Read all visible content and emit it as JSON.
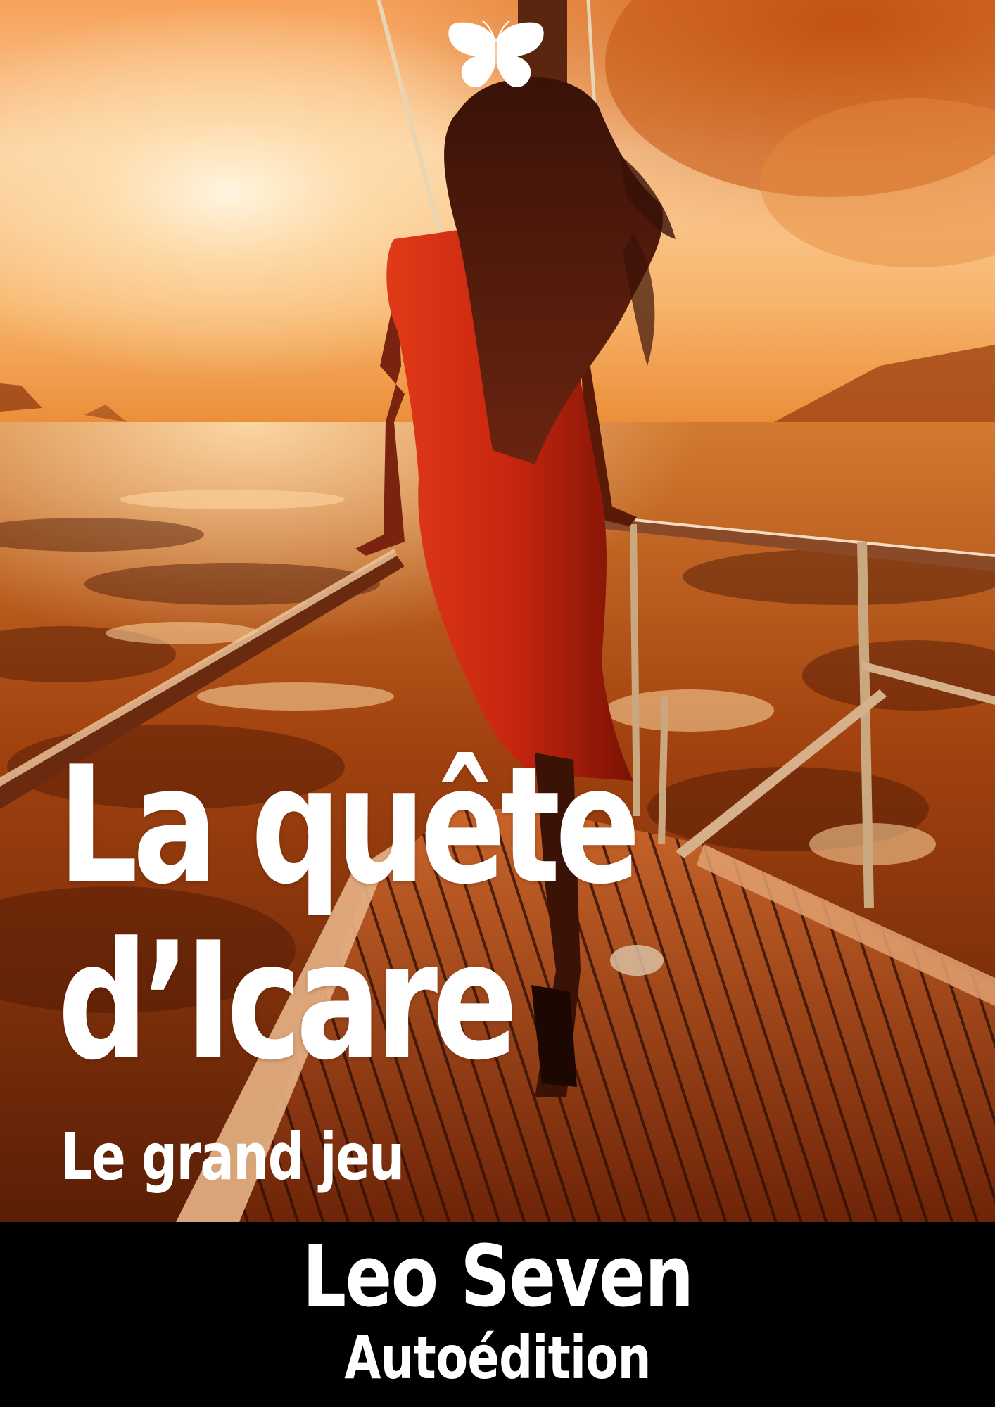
{
  "book": {
    "title_line_1": "La quête",
    "title_line_2": "d’Icare",
    "subtitle": "Le grand jeu",
    "author": "Leo Seven",
    "publisher": "Autoédition"
  },
  "logo": {
    "icon": "butterfly-icon"
  },
  "colors": {
    "text": "#ffffff",
    "band": "#000000",
    "sky": "#f7b46a",
    "sea": "#a2420f",
    "dress": "#c8260f",
    "deck": "#8a3312"
  }
}
